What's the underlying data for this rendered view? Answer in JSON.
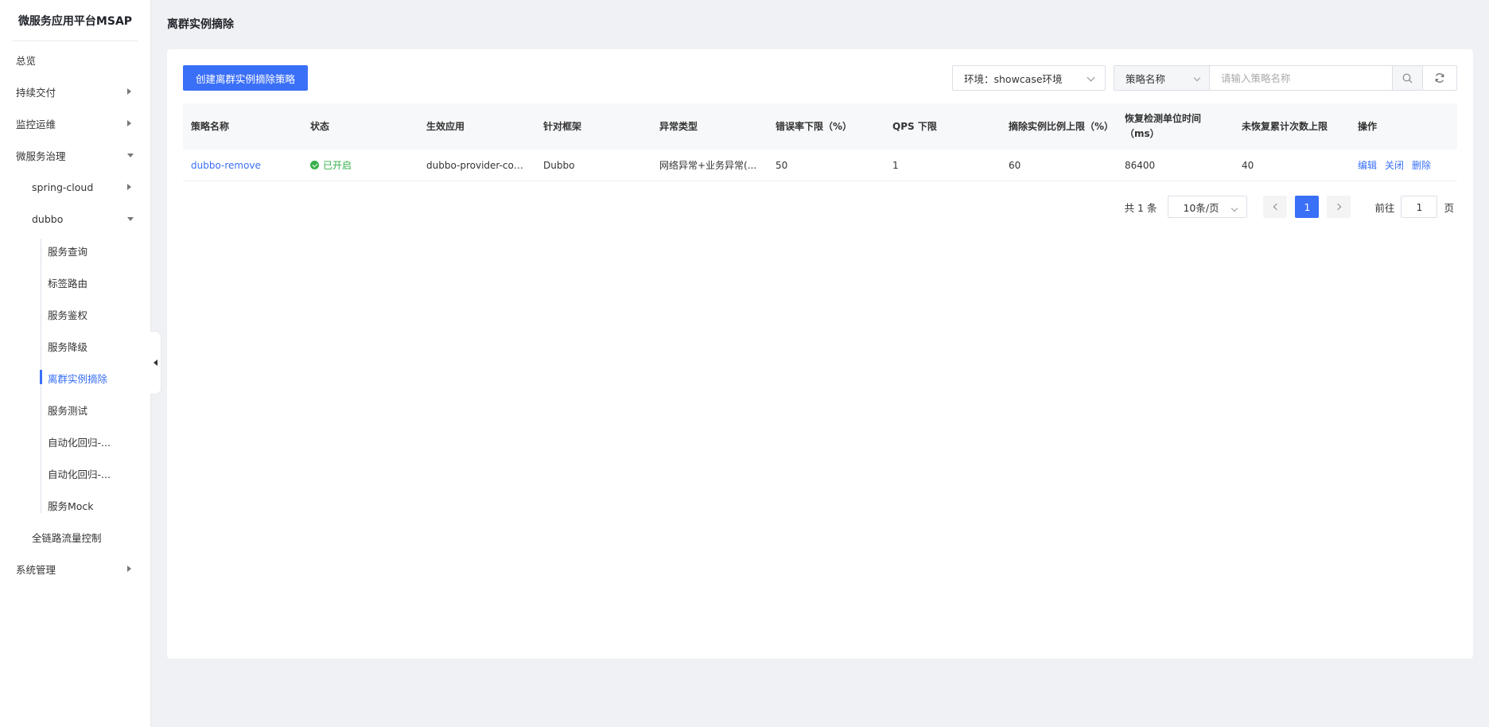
{
  "sidebar": {
    "brand": "微服务应用平台MSAP",
    "items": [
      {
        "label": "总览"
      },
      {
        "label": "持续交付"
      },
      {
        "label": "监控运维"
      },
      {
        "label": "微服务治理"
      },
      {
        "label": "spring-cloud"
      },
      {
        "label": "dubbo"
      },
      {
        "label": "服务查询"
      },
      {
        "label": "标签路由"
      },
      {
        "label": "服务鉴权"
      },
      {
        "label": "服务降级"
      },
      {
        "label": "离群实例摘除"
      },
      {
        "label": "服务测试"
      },
      {
        "label": "自动化回归-..."
      },
      {
        "label": "自动化回归-..."
      },
      {
        "label": "服务Mock"
      },
      {
        "label": "全链路流量控制"
      },
      {
        "label": "系统管理"
      }
    ]
  },
  "header": {
    "title": "离群实例摘除"
  },
  "toolbar": {
    "create_label": "创建离群实例摘除策略",
    "env_select": "环境：showcase环境",
    "search_type": "策略名称",
    "search_placeholder": "请输入策略名称"
  },
  "table": {
    "columns": [
      "策略名称",
      "状态",
      "生效应用",
      "针对框架",
      "异常类型",
      "错误率下限（%）",
      "QPS 下限",
      "摘除实例比例上限（%）",
      "恢复检测单位时间（ms）",
      "未恢复累计次数上限",
      "操作"
    ],
    "rows": [
      {
        "name": "dubbo-remove",
        "status": "已开启",
        "app": "dubbo-provider-code...",
        "framework": "Dubbo",
        "exception": "网络异常+业务异常(...",
        "error_rate": "50",
        "qps": "1",
        "ratio": "60",
        "interval": "86400",
        "max_count": "40",
        "ops": {
          "edit": "编辑",
          "close": "关闭",
          "delete": "删除"
        }
      }
    ]
  },
  "pagination": {
    "total": "共 1 条",
    "page_size": "10条/页",
    "current": "1",
    "goto_prefix": "前往",
    "goto_value": "1",
    "goto_suffix": "页"
  },
  "colors": {
    "accent": "#3a6ff7",
    "success": "#36b14a"
  },
  "icons": {
    "search": "search-icon",
    "refresh": "refresh-icon"
  }
}
